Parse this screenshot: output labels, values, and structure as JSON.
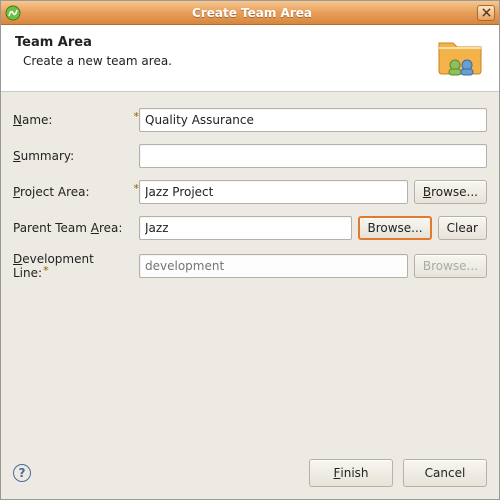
{
  "window": {
    "title": "Create Team Area"
  },
  "banner": {
    "heading": "Team Area",
    "subtext": "Create a new team area."
  },
  "labels": {
    "name_pre": "N",
    "name_post": "ame:",
    "summary_pre": "S",
    "summary_post": "ummary:",
    "project_pre": "P",
    "project_post": "roject Area:",
    "parent": "Parent Team ",
    "parent_mn": "A",
    "parent_post": "rea:",
    "devline_pre": "D",
    "devline_post": "evelopment Line:"
  },
  "fields": {
    "name": "Quality Assurance",
    "summary": "",
    "project": "Jazz Project",
    "parent": "Jazz",
    "devline_placeholder": "development"
  },
  "buttons": {
    "browse_project_pre": "B",
    "browse_project_post": "rowse...",
    "browse_parent": "Browse...",
    "clear": "Clear",
    "browse_devline": "Browse...",
    "finish_pre": "F",
    "finish_post": "inish",
    "cancel": "Cancel"
  }
}
